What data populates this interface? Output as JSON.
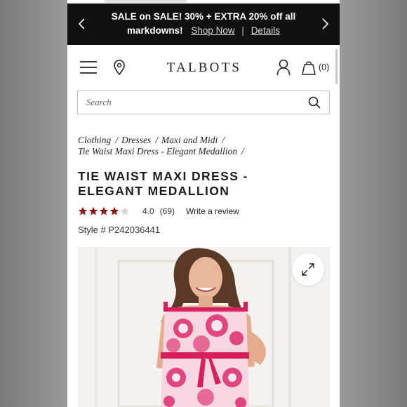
{
  "promo": {
    "headline": "SALE on SALE! 30% + EXTRA 20% off all",
    "line2_text": "markdowns!",
    "shop_now": "Shop Now",
    "separator": "|",
    "details": "Details"
  },
  "header": {
    "logo": "TALBOTS",
    "bag_count": "(0)"
  },
  "search": {
    "placeholder": "Search"
  },
  "breadcrumb": {
    "items": [
      "Clothing",
      "Dresses",
      "Maxi and Midi",
      "Tie Waist Maxi Dress - Elegant Medallion"
    ],
    "separator": "/"
  },
  "product": {
    "title": "TIE WAIST MAXI DRESS - ELEGANT MEDALLION",
    "rating_value": "4.0",
    "rating_count": "(69)",
    "rating_stars": 4,
    "rating_max": 5,
    "write_review": "Write a review",
    "style_number": "Style # P242036441"
  },
  "colors": {
    "promo_bg": "#111111",
    "star_filled": "#8b1a1a",
    "star_empty": "#d4d4d4",
    "dress_pink": "#e0457e"
  },
  "icons": {
    "menu": "hamburger-menu-icon",
    "location": "map-pin-icon",
    "account": "user-icon",
    "bag": "shopping-bag-icon",
    "search": "search-icon",
    "zoom": "expand-icon",
    "prev": "chevron-left-icon",
    "next": "chevron-right-icon"
  }
}
